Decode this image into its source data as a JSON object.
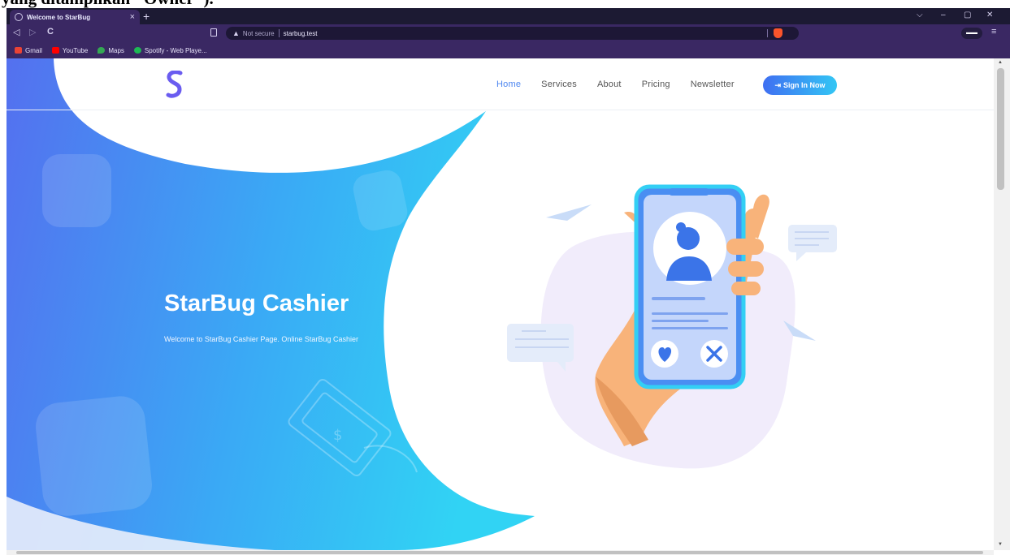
{
  "document": {
    "caption": "yang ditampilkan \"Owner\")."
  },
  "browser": {
    "tab_title": "Welcome to StarBug",
    "tab_close": "×",
    "new_tab": "+",
    "not_secure": "Not secure",
    "url": "starbug.test",
    "controls": {
      "dropdown": "⌵",
      "minimize": "–",
      "restore": "▢",
      "close": "✕"
    },
    "nav": {
      "back": "◁",
      "forward": "▷",
      "reload": "C",
      "menu": "≡"
    },
    "bookmarks": [
      {
        "label": "Gmail",
        "color": "#ea4335"
      },
      {
        "label": "YouTube",
        "color": "#ff0000"
      },
      {
        "label": "Maps",
        "color": "#34a853"
      },
      {
        "label": "Spotify - Web Playe...",
        "color": "#1db954"
      }
    ]
  },
  "site": {
    "nav_links": [
      "Home",
      "Services",
      "About",
      "Pricing",
      "Newsletter"
    ],
    "active_link": "Home",
    "sign_in_label": "Sign In Now",
    "hero_title": "StarBug Cashier",
    "hero_subtitle": "Welcome to StarBug Cashier Page. Online StarBug Cashier"
  },
  "colors": {
    "chrome_dark": "#1c1a33",
    "chrome": "#3a2863",
    "accent_blue": "#4d86f0",
    "hero_gradient_start": "#4f6ff0",
    "hero_gradient_end": "#33cff4"
  }
}
